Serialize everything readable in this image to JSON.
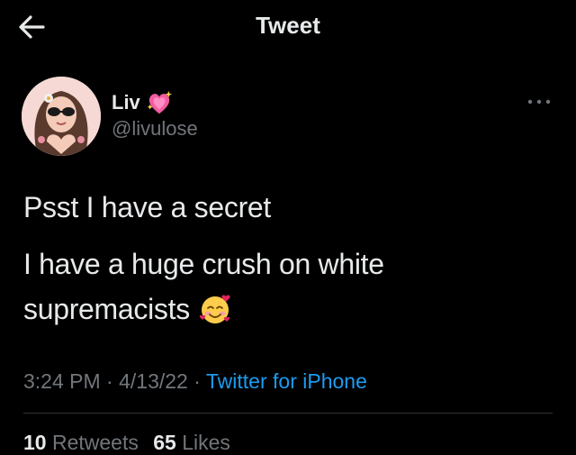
{
  "header": {
    "title": "Tweet",
    "back_icon": "arrow-left-icon"
  },
  "author": {
    "name": "Liv",
    "name_emoji": "sparkling-heart-emoji",
    "handle": "@livulose",
    "avatar": "profile-avatar"
  },
  "more_icon": "ellipsis-icon",
  "tweet": {
    "line1": "Psst I have a secret",
    "line2": "I have a huge crush on white",
    "line3": "supremacists",
    "line3_emoji": "smiling-face-with-hearts-emoji"
  },
  "meta": {
    "time": "3:24 PM",
    "sep1": " · ",
    "date": "4/13/22",
    "sep2": " · ",
    "source": "Twitter for iPhone"
  },
  "stats": {
    "retweets_count": "10",
    "retweets_label": "Retweets",
    "likes_count": "65",
    "likes_label": "Likes"
  },
  "colors": {
    "background": "#000000",
    "text": "#e7e9ea",
    "secondary": "#71767b",
    "link": "#1d9bf0",
    "divider": "#2f3336"
  }
}
